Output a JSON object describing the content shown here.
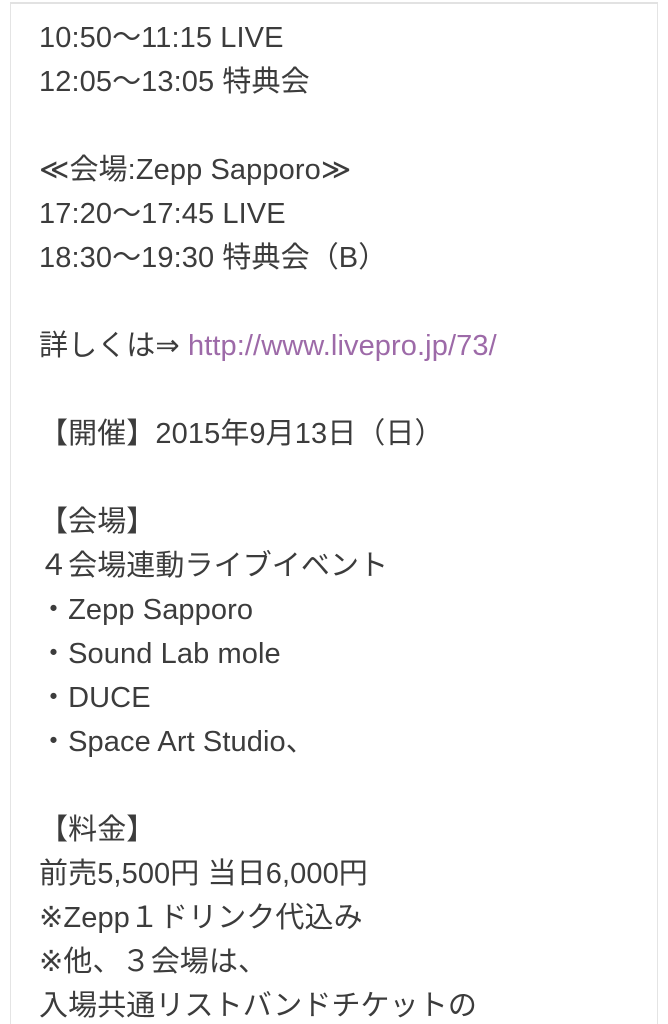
{
  "document": {
    "title_visible": false,
    "text_color": "#3c3c3c",
    "link_color": "#9d6aa8",
    "background_color": "#ffffff",
    "border_color": "#e4e4e4"
  },
  "content": {
    "lines": [
      {
        "id": "schedule-live-1",
        "text": "10:50〜11:15 LIVE"
      },
      {
        "id": "schedule-tokutenkai-1",
        "text": "12:05〜13:05 特典会"
      },
      {
        "id": "spacer-1",
        "text": ""
      },
      {
        "id": "venue-heading-zepp",
        "text": "≪会場:Zepp Sapporo≫"
      },
      {
        "id": "schedule-live-2",
        "text": "17:20〜17:45 LIVE"
      },
      {
        "id": "schedule-tokutenkai-2",
        "text": "18:30〜19:30 特典会（B）"
      },
      {
        "id": "spacer-2",
        "text": ""
      },
      {
        "id": "details-link-line",
        "text": "詳しくは⇒ ",
        "link": {
          "label": "http://www.livepro.jp/73/",
          "name": "livepro-details-link"
        }
      },
      {
        "id": "spacer-3",
        "text": ""
      },
      {
        "id": "event-date",
        "text": "【開催】2015年9月13日（日）"
      },
      {
        "id": "spacer-4",
        "text": ""
      },
      {
        "id": "venue-section-heading",
        "text": "【会場】"
      },
      {
        "id": "venue-summary",
        "text": "４会場連動ライブイベント"
      },
      {
        "id": "venue-item-1",
        "text": "・Zepp Sapporo"
      },
      {
        "id": "venue-item-2",
        "text": "・Sound Lab mole"
      },
      {
        "id": "venue-item-3",
        "text": "・DUCE"
      },
      {
        "id": "venue-item-4",
        "text": "・Space Art Studio、"
      },
      {
        "id": "spacer-5",
        "text": ""
      },
      {
        "id": "price-section-heading",
        "text": "【料金】"
      },
      {
        "id": "price-amounts",
        "text": "前売5,500円 当日6,000円"
      },
      {
        "id": "price-note-1",
        "text": "※Zepp１ドリンク代込み"
      },
      {
        "id": "price-note-2",
        "text": "※他、３会場は、"
      },
      {
        "id": "price-note-3",
        "text": "入場共通リストバンドチケットの"
      }
    ]
  }
}
